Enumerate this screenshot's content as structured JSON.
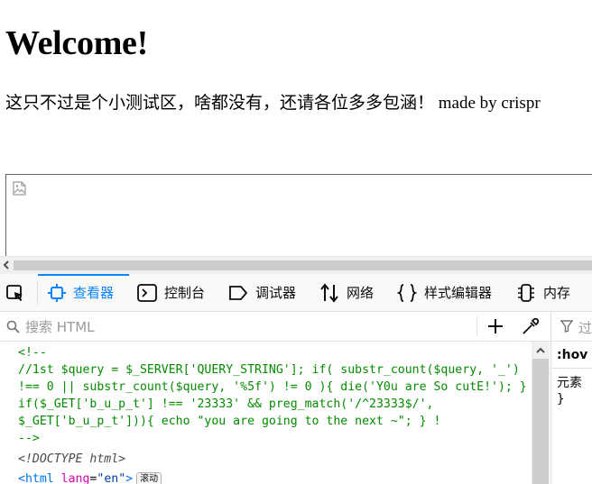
{
  "page": {
    "title": "Welcome!",
    "subtitle": "这只不过是个小测试区，啥都没有，还请各位多多包涵！ made by crispr"
  },
  "devtools": {
    "tabs": [
      {
        "label": "查看器",
        "icon": "inspector-icon",
        "active": true
      },
      {
        "label": "控制台",
        "icon": "console-icon"
      },
      {
        "label": "调试器",
        "icon": "debugger-icon"
      },
      {
        "label": "网络",
        "icon": "network-icon"
      },
      {
        "label": "样式编辑器",
        "icon": "style-editor-icon"
      },
      {
        "label": "内存",
        "icon": "memory-icon"
      }
    ],
    "search_placeholder": "搜索 HTML",
    "markup_lines": {
      "l1": "<!--",
      "l2": "//1st $query = $_SERVER['QUERY_STRING']; if( substr_count($query, '_')",
      "l3": "!== 0 || substr_count($query, '%5f') != 0 ){ die('Y0u are So cutE!'); }",
      "l4": "if($_GET['b_u_p_t'] !== '23333' && preg_match('/^23333$/',",
      "l5": "$_GET['b_u_p_t'])){ echo \"you are going to the next ~\"; } !",
      "l6": "-->",
      "l7": "<!DOCTYPE html>",
      "l8_tag_open": "<html",
      "l8_attr": "lang",
      "l8_eq": "=",
      "l8_val": "\"en\"",
      "l8_tag_close": ">",
      "scroll_badge": "滚动"
    },
    "side": {
      "filter": "过",
      "hov": ":hov",
      "element": "元素",
      "brace": "}"
    },
    "accent_color": "#0a84ff"
  }
}
